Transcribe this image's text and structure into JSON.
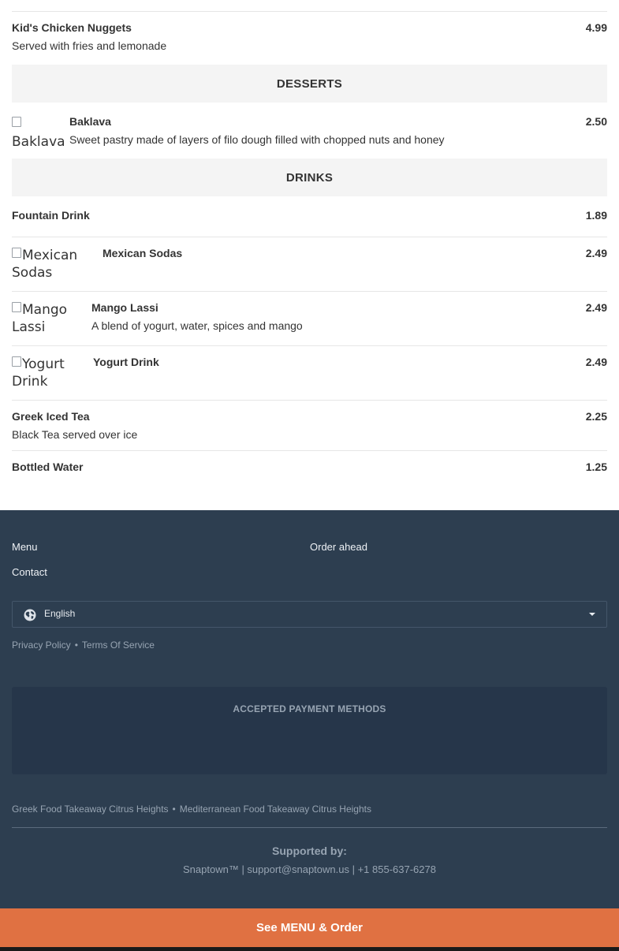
{
  "menu": {
    "top_item": {
      "name": "Kid's Chicken Nuggets",
      "description": "Served with fries and lemonade",
      "price": "4.99"
    },
    "sections": [
      {
        "title": "DESSERTS",
        "items": [
          {
            "name": "Baklava",
            "image_alt": "Baklava",
            "description": "Sweet pastry made of layers of filo dough filled with chopped nuts and honey",
            "price": "2.50"
          }
        ]
      },
      {
        "title": "DRINKS",
        "items": [
          {
            "name": "Fountain Drink",
            "price": "1.89"
          },
          {
            "name": "Mexican Sodas",
            "image_alt": "Mexican Sodas",
            "price": "2.49"
          },
          {
            "name": "Mango Lassi",
            "image_alt": "Mango Lassi",
            "description": "A blend of yogurt, water, spices and mango",
            "price": "2.49"
          },
          {
            "name": "Yogurt Drink",
            "image_alt": "Yogurt Drink",
            "price": "2.49"
          },
          {
            "name": "Greek Iced Tea",
            "description": "Black Tea served over ice",
            "price": "2.25"
          },
          {
            "name": "Bottled Water",
            "price": "1.25"
          }
        ]
      }
    ]
  },
  "footer": {
    "links": [
      "Menu",
      "Order ahead",
      "Contact"
    ],
    "language": {
      "selected": "English",
      "icon": "globe-icon"
    },
    "legal": {
      "privacy": "Privacy Policy",
      "terms": "Terms Of Service",
      "separator": "•"
    },
    "payment_title": "ACCEPTED PAYMENT METHODS",
    "seo_links": [
      "Greek Food Takeaway Citrus Heights",
      "Mediterranean Food Takeaway Citrus Heights"
    ],
    "supported_by": "Supported by:",
    "contact_line": "Snaptown™ | support@snaptown.us | +1 855-637-6278"
  },
  "cta": {
    "label": "See MENU & Order"
  },
  "colors": {
    "footer_bg": "#2d3e50",
    "cta_bg": "#e07142",
    "section_bar_bg": "#f4f4f4"
  }
}
